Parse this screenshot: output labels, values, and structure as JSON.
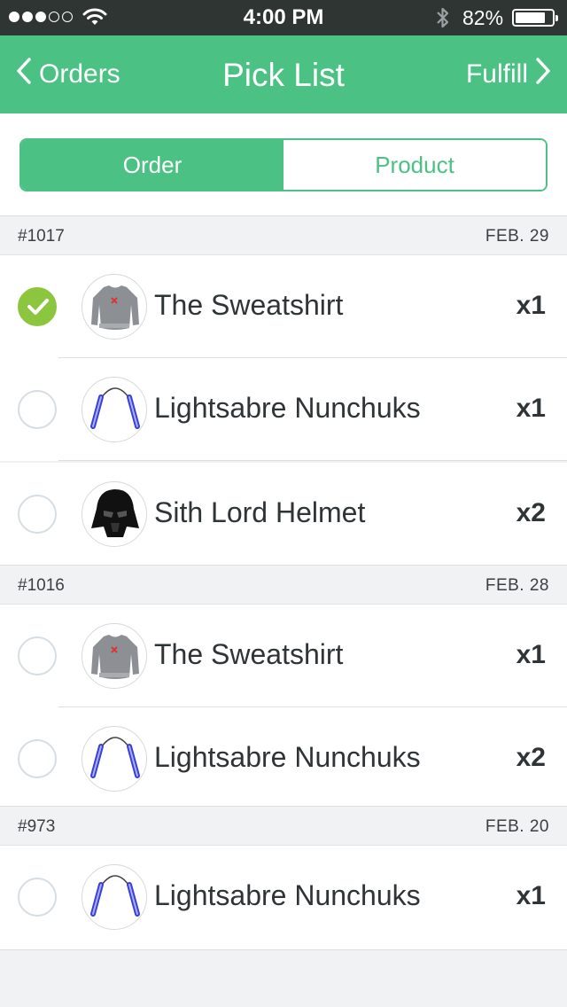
{
  "status_bar": {
    "time": "4:00 PM",
    "battery_percent": "82%",
    "battery_level": 0.82,
    "signal_dots_filled": 3,
    "signal_dots_total": 5
  },
  "nav": {
    "back_label": "Orders",
    "title": "Pick List",
    "forward_label": "Fulfill"
  },
  "segments": {
    "order_label": "Order",
    "product_label": "Product",
    "active": "order"
  },
  "colors": {
    "brand": "#4cc184",
    "checked": "#8cc63f",
    "status_bar": "#2e3532"
  },
  "groups": [
    {
      "number": "#1017",
      "date": "FEB. 29",
      "items": [
        {
          "name": "The Sweatshirt",
          "qty": "x1",
          "checked": true,
          "icon": "sweatshirt-icon"
        },
        {
          "name": "Lightsabre Nunchuks",
          "qty": "x1",
          "checked": false,
          "icon": "nunchuks-icon"
        },
        {
          "name": "Sith Lord Helmet",
          "qty": "x2",
          "checked": false,
          "icon": "helmet-icon"
        }
      ]
    },
    {
      "number": "#1016",
      "date": "FEB. 28",
      "items": [
        {
          "name": "The Sweatshirt",
          "qty": "x1",
          "checked": false,
          "icon": "sweatshirt-icon"
        },
        {
          "name": "Lightsabre Nunchuks",
          "qty": "x2",
          "checked": false,
          "icon": "nunchuks-icon"
        }
      ]
    },
    {
      "number": "#973",
      "date": "FEB. 20",
      "items": [
        {
          "name": "Lightsabre Nunchuks",
          "qty": "x1",
          "checked": false,
          "icon": "nunchuks-icon"
        }
      ]
    }
  ]
}
